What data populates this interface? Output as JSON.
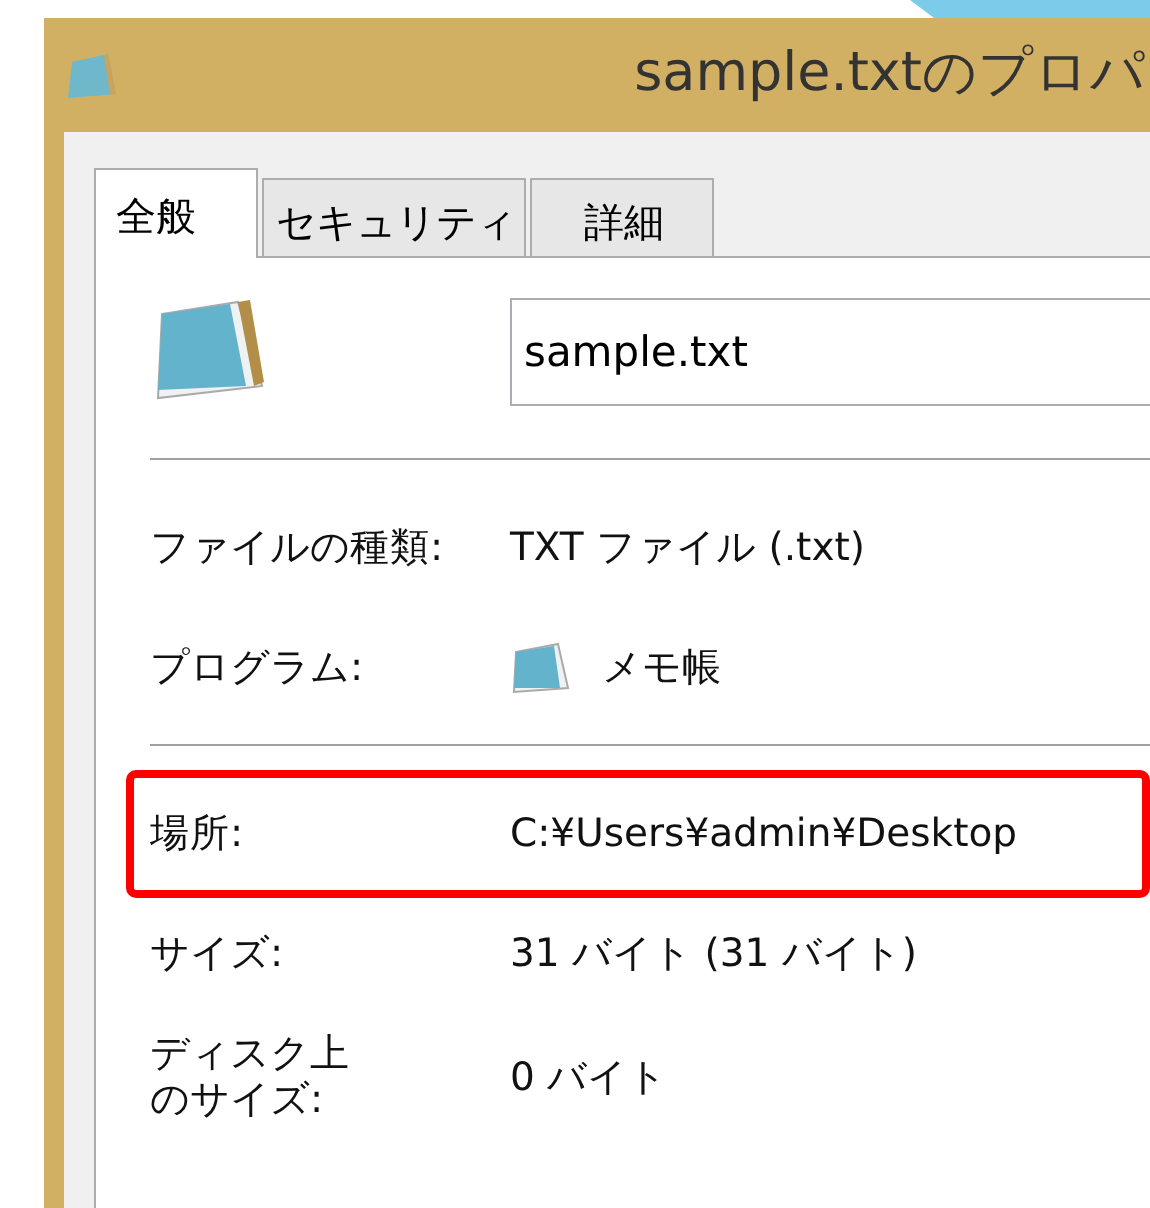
{
  "window": {
    "title": "sample.txtのプロパ"
  },
  "tabs": [
    {
      "label": "全般",
      "selected": true
    },
    {
      "label": "セキュリティ",
      "selected": false
    },
    {
      "label": "詳細",
      "selected": false
    }
  ],
  "file_name": {
    "value": "sample.txt"
  },
  "sections": [
    {
      "rows": [
        {
          "label": "ファイルの種類:",
          "value": "TXT ファイル (.txt)",
          "kind": "text",
          "highlighted": false
        },
        {
          "label": "プログラム:",
          "value": "メモ帳",
          "kind": "program",
          "highlighted": false
        }
      ]
    },
    {
      "rows": [
        {
          "label": "場所:",
          "value": "C:¥Users¥admin¥Desktop",
          "kind": "text",
          "highlighted": true
        },
        {
          "label": "サイズ:",
          "value": "31 バイト (31 バイト)",
          "kind": "text",
          "highlighted": false
        },
        {
          "label": "ディスク上のサイズ:",
          "value": "0 バイト",
          "kind": "wrapped",
          "highlighted": false
        }
      ]
    }
  ]
}
